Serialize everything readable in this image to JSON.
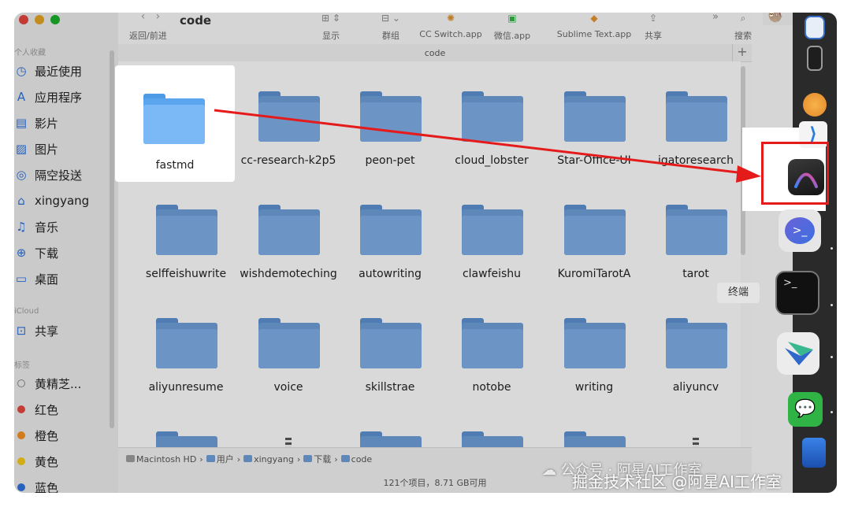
{
  "toolbar": {
    "title": "code",
    "nav_label": "返回/前进",
    "view_label": "显示",
    "group_label": "群组",
    "apps": [
      {
        "label": "CC Switch.app"
      },
      {
        "label": "微信.app"
      },
      {
        "label": "Sublime Text.app"
      }
    ],
    "share_label": "共享",
    "search_label": "搜索"
  },
  "path_title": "code",
  "sidebar": {
    "favorites_header": "个人收藏",
    "favorites": [
      {
        "label": "最近使用",
        "icon": "clock-icon"
      },
      {
        "label": "应用程序",
        "icon": "apps-icon"
      },
      {
        "label": "影片",
        "icon": "film-icon"
      },
      {
        "label": "图片",
        "icon": "photo-icon"
      },
      {
        "label": "隔空投送",
        "icon": "airdrop-icon"
      },
      {
        "label": "xingyang",
        "icon": "home-icon"
      },
      {
        "label": "音乐",
        "icon": "music-icon"
      },
      {
        "label": "下载",
        "icon": "download-icon"
      },
      {
        "label": "桌面",
        "icon": "desktop-icon"
      }
    ],
    "icloud_header": "iCloud",
    "icloud": [
      {
        "label": "共享",
        "icon": "shared-folder-icon"
      }
    ],
    "tags_header": "标签",
    "tags": [
      {
        "label": "黄精芝...",
        "color": "#f3f3f3"
      },
      {
        "label": "红色",
        "color": "#e0463c"
      },
      {
        "label": "橙色",
        "color": "#ee8c1f"
      },
      {
        "label": "黄色",
        "color": "#f0c419"
      },
      {
        "label": "蓝色",
        "color": "#2f6fd8"
      }
    ]
  },
  "folders": [
    {
      "name": "fastmd"
    },
    {
      "name": "cc-research-k2p5"
    },
    {
      "name": "peon-pet"
    },
    {
      "name": "cloud_lobster"
    },
    {
      "name": "Star-Office-UI"
    },
    {
      "name": "igatoresearch"
    },
    {
      "name": "selffeishuwrite"
    },
    {
      "name": "wishdemoteching"
    },
    {
      "name": "autowriting"
    },
    {
      "name": "clawfeishu"
    },
    {
      "name": "KuromiTarotA"
    },
    {
      "name": "tarot"
    },
    {
      "name": "aliyunresume"
    },
    {
      "name": "voice"
    },
    {
      "name": "skillstrae"
    },
    {
      "name": "notobe"
    },
    {
      "name": "writing"
    },
    {
      "name": "aliyuncv"
    }
  ],
  "breadcrumb": [
    "Macintosh HD",
    "用户",
    "xingyang",
    "下载",
    "code"
  ],
  "status_text": "121个项目，8.71 GB可用",
  "dock_tooltip": "终端",
  "watermark_1": "公众号 · 阿星AI工作室",
  "watermark_2": "掘金技术社区 @阿星AI工作室",
  "colors": {
    "highlight_border": "#e51b1b",
    "arrow": "#e51b1b",
    "folder": "#7ba9e0"
  }
}
